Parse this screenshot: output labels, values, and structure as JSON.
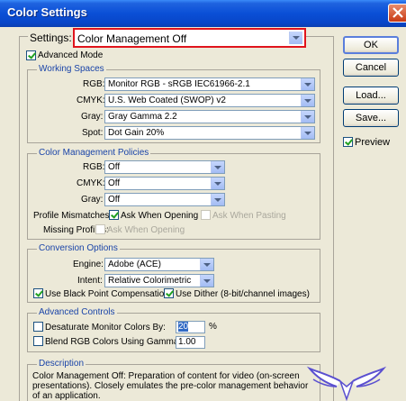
{
  "window": {
    "title": "Color Settings"
  },
  "settings": {
    "label": "Settings:",
    "value": "Color Management Off"
  },
  "advanced_mode": {
    "label": "Advanced Mode",
    "checked": true
  },
  "working_spaces": {
    "title": "Working Spaces",
    "rgb": {
      "label": "RGB:",
      "value": "Monitor RGB - sRGB IEC61966-2.1"
    },
    "cmyk": {
      "label": "CMYK:",
      "value": "U.S. Web Coated (SWOP) v2"
    },
    "gray": {
      "label": "Gray:",
      "value": "Gray Gamma 2.2"
    },
    "spot": {
      "label": "Spot:",
      "value": "Dot Gain 20%"
    }
  },
  "policies": {
    "title": "Color Management Policies",
    "rgb": {
      "label": "RGB:",
      "value": "Off"
    },
    "cmyk": {
      "label": "CMYK:",
      "value": "Off"
    },
    "gray": {
      "label": "Gray:",
      "value": "Off"
    },
    "profile_mismatches": {
      "label": "Profile Mismatches:",
      "ask_opening": "Ask When Opening",
      "ask_pasting": "Ask When Pasting"
    },
    "missing_profiles": {
      "label": "Missing Profiles:",
      "ask_opening": "Ask When Opening"
    }
  },
  "conversion": {
    "title": "Conversion Options",
    "engine": {
      "label": "Engine:",
      "value": "Adobe (ACE)"
    },
    "intent": {
      "label": "Intent:",
      "value": "Relative Colorimetric"
    },
    "black_point": "Use Black Point Compensation",
    "dither": "Use Dither (8-bit/channel images)"
  },
  "advanced_controls": {
    "title": "Advanced Controls",
    "desaturate": {
      "label": "Desaturate Monitor Colors By:",
      "value": "20",
      "unit": "%"
    },
    "blend": {
      "label": "Blend RGB Colors Using Gamma:",
      "value": "1.00"
    }
  },
  "description": {
    "title": "Description",
    "text": "Color Management Off:  Preparation of content for video (on-screen presentations). Closely emulates the pre-color management behavior of an application."
  },
  "buttons": {
    "ok": "OK",
    "cancel": "Cancel",
    "load": "Load...",
    "save": "Save..."
  },
  "preview": {
    "label": "Preview",
    "checked": true
  },
  "colors": {
    "title_bar": "#0a4fd6",
    "highlight_border": "#e0141c",
    "group_title": "#1a44a8"
  }
}
